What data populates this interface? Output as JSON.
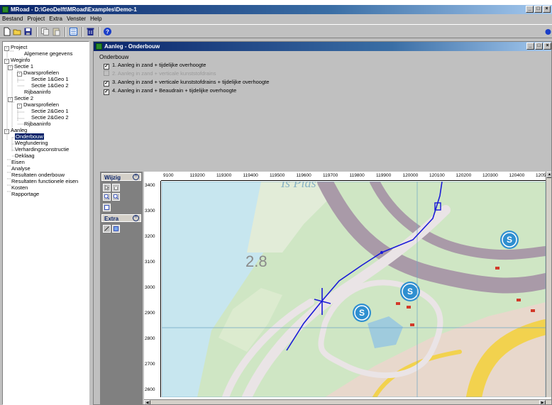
{
  "app": {
    "title": "MRoad - D:\\GeoDelft\\MRoad\\Examples\\Demo-1",
    "window_buttons": [
      "_",
      "□",
      "×"
    ]
  },
  "menu": [
    "Bestand",
    "Project",
    "Extra",
    "Venster",
    "Help"
  ],
  "toolbar": {
    "icons": [
      "new-icon",
      "open-icon",
      "save-icon",
      "copy-icon",
      "paste-icon",
      "properties-icon",
      "delete-icon",
      "help-icon"
    ]
  },
  "tree": {
    "items": [
      {
        "label": "Project",
        "level": 0,
        "expander": "-"
      },
      {
        "label": "Algemene gegevens",
        "level": 2
      },
      {
        "label": "Weginfo",
        "level": 0,
        "expander": "-"
      },
      {
        "label": "Sectie 1",
        "level": 1,
        "expander": "-"
      },
      {
        "label": "Dwarsprofielen",
        "level": 2,
        "expander": "-"
      },
      {
        "label": "Sectie 1&Geo 1",
        "level": 3
      },
      {
        "label": "Sectie 1&Geo 2",
        "level": 3
      },
      {
        "label": "Rijbaaninfo",
        "level": 2
      },
      {
        "label": "Sectie 2",
        "level": 1,
        "expander": "-"
      },
      {
        "label": "Dwarsprofielen",
        "level": 2,
        "expander": "-"
      },
      {
        "label": "Sectie 2&Geo 1",
        "level": 3
      },
      {
        "label": "Sectie 2&Geo 2",
        "level": 3
      },
      {
        "label": "Rijbaaninfo",
        "level": 2
      },
      {
        "label": "Aanleg",
        "level": 0,
        "expander": "-"
      },
      {
        "label": "Onderbouw",
        "level": 1,
        "selected": true
      },
      {
        "label": "Wegfundering",
        "level": 1
      },
      {
        "label": "Verhardingsconstructie",
        "level": 1
      },
      {
        "label": "Deklaag",
        "level": 1
      },
      {
        "label": "Eisen",
        "level": 0
      },
      {
        "label": "Analyse",
        "level": 0
      },
      {
        "label": "Resultaten onderbouw",
        "level": 0
      },
      {
        "label": "Resultaten functionele eisen",
        "level": 0
      },
      {
        "label": "Kosten",
        "level": 0
      },
      {
        "label": "Rapportage",
        "level": 0
      }
    ]
  },
  "child": {
    "title": "Aanleg - Onderbouw",
    "group_label": "Onderbouw",
    "options": [
      {
        "label": "1. Aanleg in zand + tijdelijke overhoogte",
        "checked": true,
        "enabled": true
      },
      {
        "label": "2. Aanleg in zand + verticale kunststofdrains",
        "checked": false,
        "enabled": false
      },
      {
        "label": "3. Aanleg in zand + verticale kunststofdrains + tijdelijke overhoogte",
        "checked": true,
        "enabled": true
      },
      {
        "label": "4. Aanleg in zand + Beaudrain + tijdelijke overhoogte",
        "checked": true,
        "enabled": true
      }
    ]
  },
  "panels": {
    "wijzig": "Wijzig",
    "extra": "Extra",
    "collapse_glyph": "ꟾ"
  },
  "map": {
    "ruler_x": [
      "9100",
      "119200",
      "119300",
      "119400",
      "119500",
      "119600",
      "119700",
      "119800",
      "119900",
      "120000",
      "120100",
      "120200",
      "120300",
      "120400",
      "12050"
    ],
    "ruler_y": [
      "3400",
      "3300",
      "3200",
      "3100",
      "3000",
      "2900",
      "2800",
      "2700",
      "2600"
    ],
    "label_number": "2.8",
    "label_place": "Is Plas",
    "badge": "S",
    "route_color": "#1a1ad8",
    "water_color": "#c7e6ef",
    "road_color": "#a99aa8",
    "main_road_color": "#f2d24e",
    "land_color": "#cfe6c4"
  }
}
